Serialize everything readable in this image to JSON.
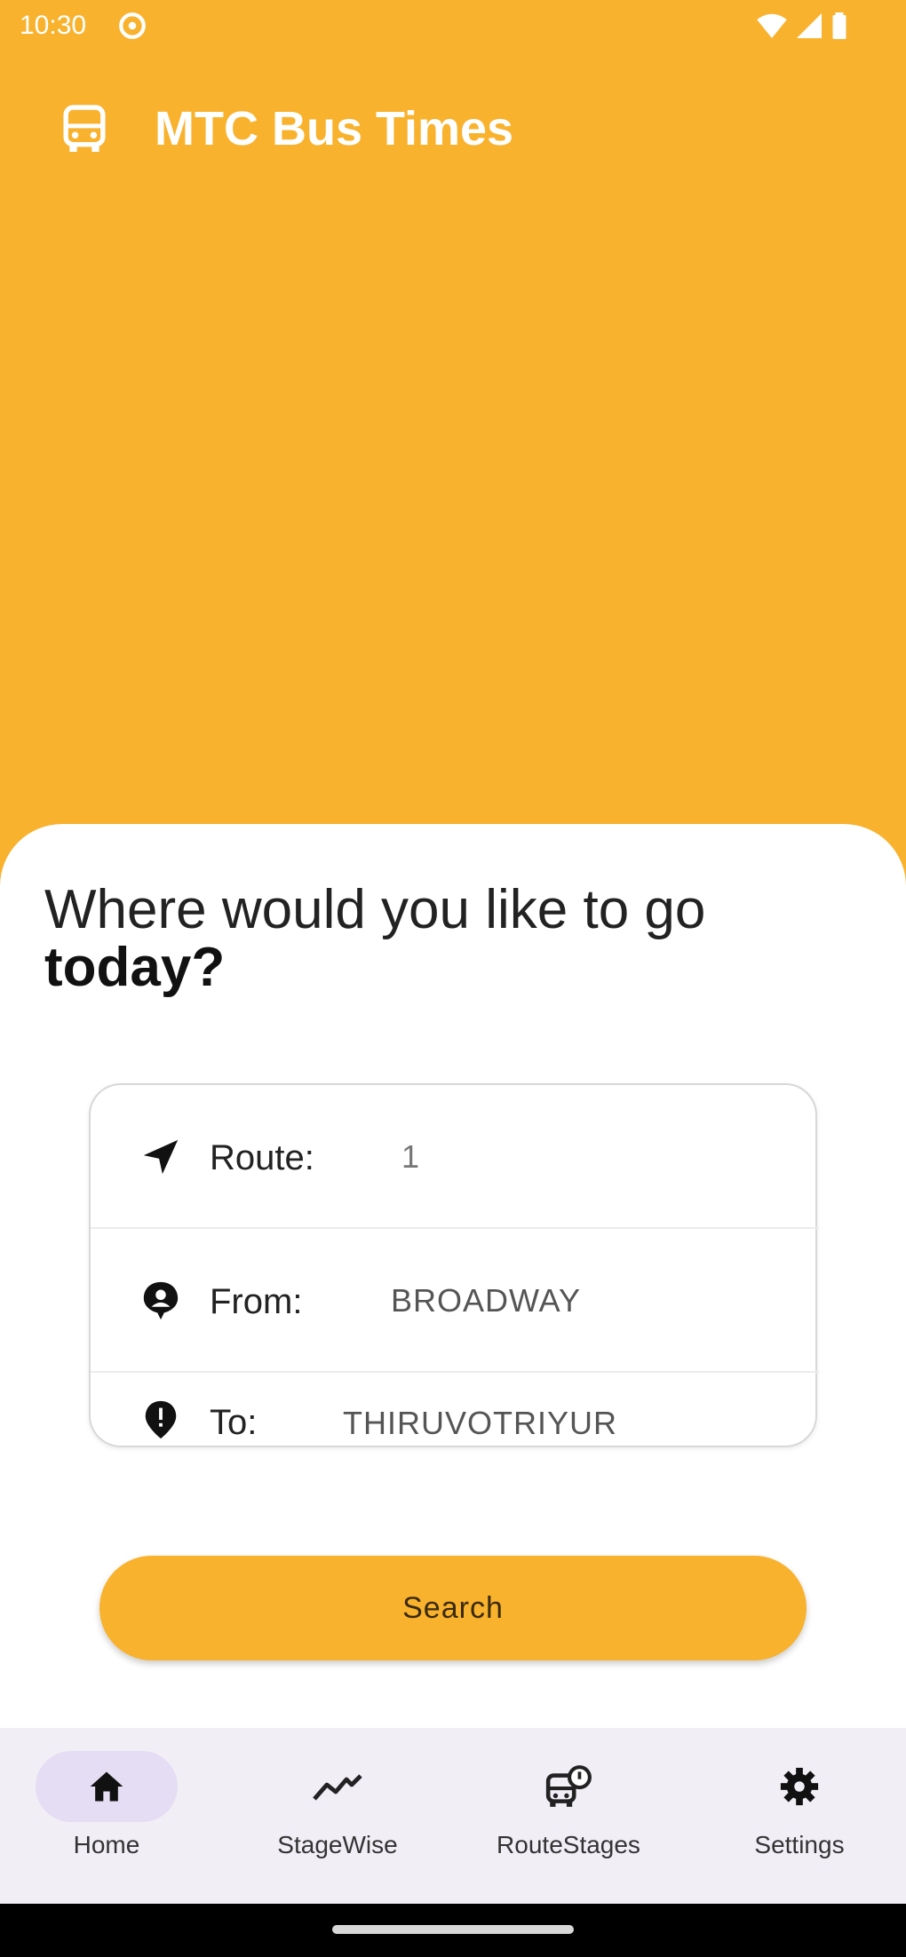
{
  "status_bar": {
    "time": "10:30",
    "icons": [
      "settings-icon",
      "wifi-icon",
      "signal-icon",
      "battery-icon"
    ]
  },
  "app_bar": {
    "icon": "bus-icon",
    "title": "MTC Bus Times"
  },
  "main": {
    "headline_line1": "Where would you like to go",
    "headline_line2": "today?",
    "form": {
      "route": {
        "icon": "navigation-arrow-icon",
        "label": "Route:",
        "value": "1"
      },
      "from": {
        "icon": "person-pin-icon",
        "label": "From:",
        "value": "BROADWAY"
      },
      "to": {
        "icon": "location-pin-icon",
        "label": "To:",
        "value": "THIRUVOTRIYUR"
      }
    },
    "search_label": "Search"
  },
  "bottom_nav": {
    "items": [
      {
        "label": "Home",
        "icon": "home-icon",
        "active": true
      },
      {
        "label": "StageWise",
        "icon": "trending-icon",
        "active": false
      },
      {
        "label": "RouteStages",
        "icon": "route-bus-icon",
        "active": false
      },
      {
        "label": "Settings",
        "icon": "settings-icon",
        "active": false
      }
    ]
  },
  "colors": {
    "primary": "#F8B22E",
    "nav_background": "#F2EEF6",
    "nav_active_pill": "#E5DDF3"
  }
}
